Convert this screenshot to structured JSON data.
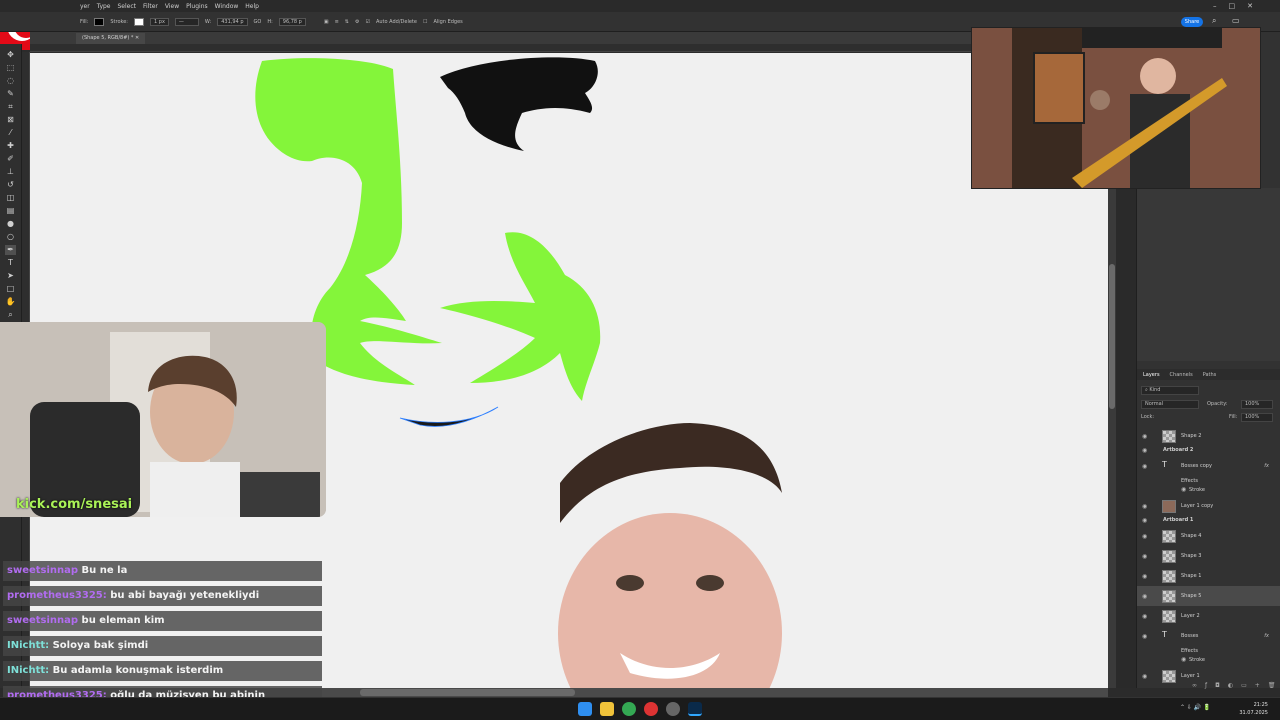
{
  "app": {
    "menu": [
      "yer",
      "Type",
      "Select",
      "Filter",
      "View",
      "Plugins",
      "Window",
      "Help"
    ],
    "share_label": "Share"
  },
  "options": {
    "fill_label": "Fill:",
    "stroke_label": "Stroke:",
    "stroke_width": "1 px",
    "w_label": "W:",
    "w_value": "431,94 p",
    "go_label": "GO",
    "h_label": "H:",
    "h_value": "96,78 p",
    "auto_add_delete": "Auto Add/Delete",
    "align_edges": "Align Edges"
  },
  "document": {
    "tab_title": "(Shape 5, RGB/8#) *"
  },
  "layers_panel": {
    "tabs": [
      "Layers",
      "Channels",
      "Paths"
    ],
    "kind_label": "Kind",
    "blend_mode": "Normal",
    "opacity_label": "Opacity:",
    "opacity_value": "100%",
    "lock_label": "Lock:",
    "fill_label": "Fill:",
    "fill_value": "100%",
    "layers": [
      {
        "name": "Shape 2",
        "type": "shape"
      },
      {
        "name": "Artboard 2",
        "type": "group"
      },
      {
        "name": "Bosses copy",
        "type": "text",
        "fx": "fx"
      },
      {
        "name": "Effects",
        "type": "sub"
      },
      {
        "name": "Stroke",
        "type": "sub"
      },
      {
        "name": "Layer 1 copy",
        "type": "image"
      },
      {
        "name": "Artboard 1",
        "type": "group"
      },
      {
        "name": "Shape 4",
        "type": "shape"
      },
      {
        "name": "Shape 3",
        "type": "shape"
      },
      {
        "name": "Shape 1",
        "type": "shape"
      },
      {
        "name": "Shape 5",
        "type": "shape",
        "selected": true
      },
      {
        "name": "Layer 2",
        "type": "shape"
      },
      {
        "name": "Bosses",
        "type": "text",
        "fx": "fx"
      },
      {
        "name": "Effects",
        "type": "sub"
      },
      {
        "name": "Stroke",
        "type": "sub"
      },
      {
        "name": "Layer 1",
        "type": "shape"
      }
    ]
  },
  "stream": {
    "kick_handle": "kick.com/snesai"
  },
  "chat": [
    {
      "user": "sweetsinnap",
      "user_color": "#b16cf0",
      "message": "Bu ne la"
    },
    {
      "user": "prometheus3325:",
      "user_color": "#b16cf0",
      "message": "bu abi bayağı yetenekliydi"
    },
    {
      "user": "sweetsinnap",
      "user_color": "#b16cf0",
      "message": "bu eleman kim"
    },
    {
      "user": "INichtt:",
      "user_color": "#7ee0d8",
      "message": "Soloya bak şimdi"
    },
    {
      "user": "INichtt:",
      "user_color": "#7ee0d8",
      "message": "Bu adamla konuşmak isterdim"
    },
    {
      "user": "prometheus3325:",
      "user_color": "#b16cf0",
      "message": "oğlu da müzisyen bu abinin"
    }
  ],
  "taskbar": {
    "time": "21:25",
    "date": "31.07.2025"
  },
  "colors": {
    "accent_green": "#84f53a",
    "share_blue": "#1473e6",
    "flag_red": "#e30a17"
  }
}
